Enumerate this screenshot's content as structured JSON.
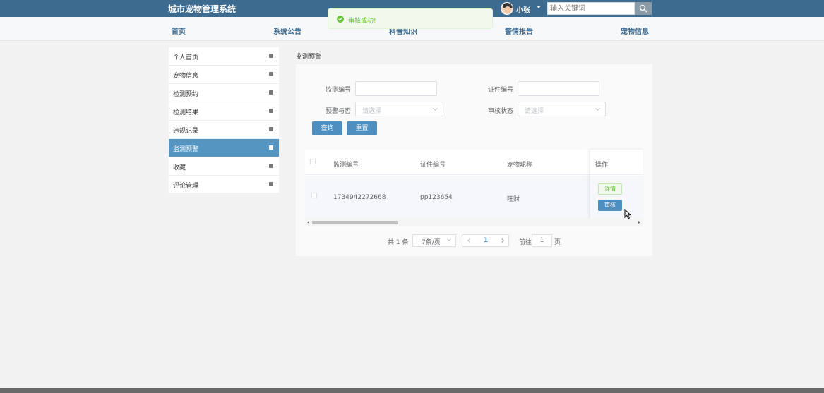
{
  "header": {
    "title": "城市宠物管理系统",
    "username": "小张",
    "search_placeholder": "输入关键词",
    "search_icon": "search-icon",
    "bar_color": "#3d6a8f"
  },
  "nav": {
    "items": [
      {
        "label": "首页"
      },
      {
        "label": "系统公告"
      },
      {
        "label": "科普知识"
      },
      {
        "label": "警情报告"
      },
      {
        "label": "宠物信息"
      }
    ]
  },
  "toast": {
    "message": "审核成功!",
    "icon": "check-circle-icon"
  },
  "sidebar": {
    "items": [
      {
        "label": "个人首页",
        "active": false
      },
      {
        "label": "宠物信息",
        "active": false
      },
      {
        "label": "检测预约",
        "active": false
      },
      {
        "label": "检测结果",
        "active": false
      },
      {
        "label": "违规记录",
        "active": false
      },
      {
        "label": "监测预警",
        "active": true
      },
      {
        "label": "收藏",
        "active": false
      },
      {
        "label": "评论管理",
        "active": false
      }
    ],
    "active_color": "#5495c2"
  },
  "page": {
    "breadcrumb": "监测预警"
  },
  "filters": {
    "monitor_no_label": "监测编号",
    "monitor_no_value": "",
    "cert_no_label": "证件编号",
    "cert_no_value": "",
    "warning_label": "预警与否",
    "warning_placeholder": "请选择",
    "review_label": "审核状态",
    "review_placeholder": "请选择",
    "query_button": "查询",
    "reset_button": "重置"
  },
  "table": {
    "columns": [
      "监测编号",
      "证件编号",
      "宠物昵称",
      "操作"
    ],
    "rows": [
      {
        "monitor_no": "1734942272668",
        "cert_no": "pp123654",
        "pet_name": "旺财"
      }
    ],
    "detail_button": "详情",
    "review_button": "审核"
  },
  "pagination": {
    "total": "共 1 条",
    "page_size": "7条/页",
    "current_page": "1",
    "goto_label": "前往",
    "goto_value": "1",
    "page_unit": "页"
  }
}
